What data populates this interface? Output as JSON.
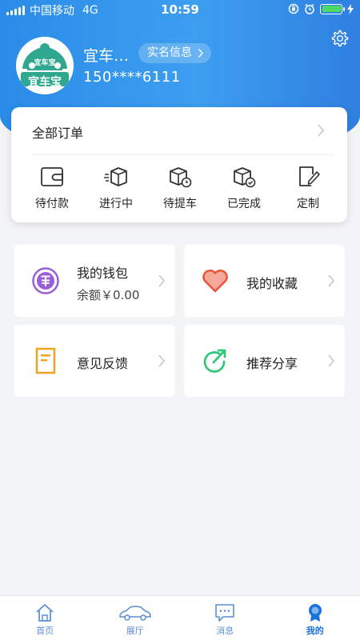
{
  "status_bar": {
    "carrier": "中国移动",
    "network": "4G",
    "time": "10:59"
  },
  "profile": {
    "logo_text_top": "宜车宝",
    "logo_text_bottom": "宜车宝",
    "name": "宜车…",
    "verify_label": "实名信息",
    "phone": "150****6111"
  },
  "orders": {
    "all_label": "全部订单",
    "items": [
      {
        "label": "待付款",
        "icon": "wallet-icon"
      },
      {
        "label": "进行中",
        "icon": "box-moving-icon"
      },
      {
        "label": "待提车",
        "icon": "box-clock-icon"
      },
      {
        "label": "已完成",
        "icon": "box-check-icon"
      },
      {
        "label": "定制",
        "icon": "edit-doc-icon"
      }
    ]
  },
  "tiles": {
    "wallet": {
      "title": "我的钱包",
      "balance": "余额￥0.00"
    },
    "favorites": {
      "title": "我的收藏"
    },
    "feedback": {
      "title": "意见反馈"
    },
    "share": {
      "title": "推荐分享"
    }
  },
  "nav": {
    "items": [
      {
        "label": "首页",
        "icon": "home-icon"
      },
      {
        "label": "展厅",
        "icon": "car-icon"
      },
      {
        "label": "消息",
        "icon": "message-icon"
      },
      {
        "label": "我的",
        "icon": "profile-badge-icon"
      }
    ],
    "active": "我的"
  },
  "colors": {
    "header_blue": "#2a8ce8",
    "active_nav": "#1a73d9",
    "wallet_purple": "#9a5fd8",
    "favorite_red": "#e8553a",
    "feedback_orange": "#f1a321",
    "share_green": "#37c77c"
  }
}
